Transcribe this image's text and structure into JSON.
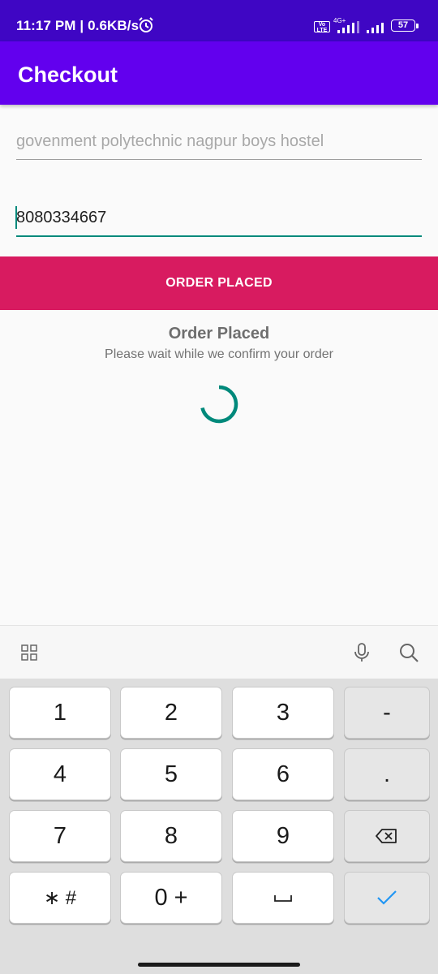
{
  "status_bar": {
    "time_speed": "11:17 PM | 0.6KB/s",
    "network": "4G+",
    "volte": "Vo LTE",
    "battery": "57"
  },
  "app_bar": {
    "title": "Checkout"
  },
  "form": {
    "address_placeholder": "govenment polytechnic nagpur boys hostel",
    "address_value": "",
    "phone_value": "8080334667",
    "order_button": "ORDER PLACED"
  },
  "dialog": {
    "title": "Order Placed",
    "message": "Please wait while we confirm your order"
  },
  "keyboard": {
    "keys": {
      "k1": "1",
      "k2": "2",
      "k3": "3",
      "minus": "-",
      "k4": "4",
      "k5": "5",
      "k6": "6",
      "dot": ".",
      "k7": "7",
      "k8": "8",
      "k9": "9",
      "star_hash": "∗ #",
      "zero_plus": "0 +"
    }
  },
  "colors": {
    "status_bar": "#3f06c4",
    "app_bar": "#6200ee",
    "accent": "#00897b",
    "button": "#d81b60"
  }
}
